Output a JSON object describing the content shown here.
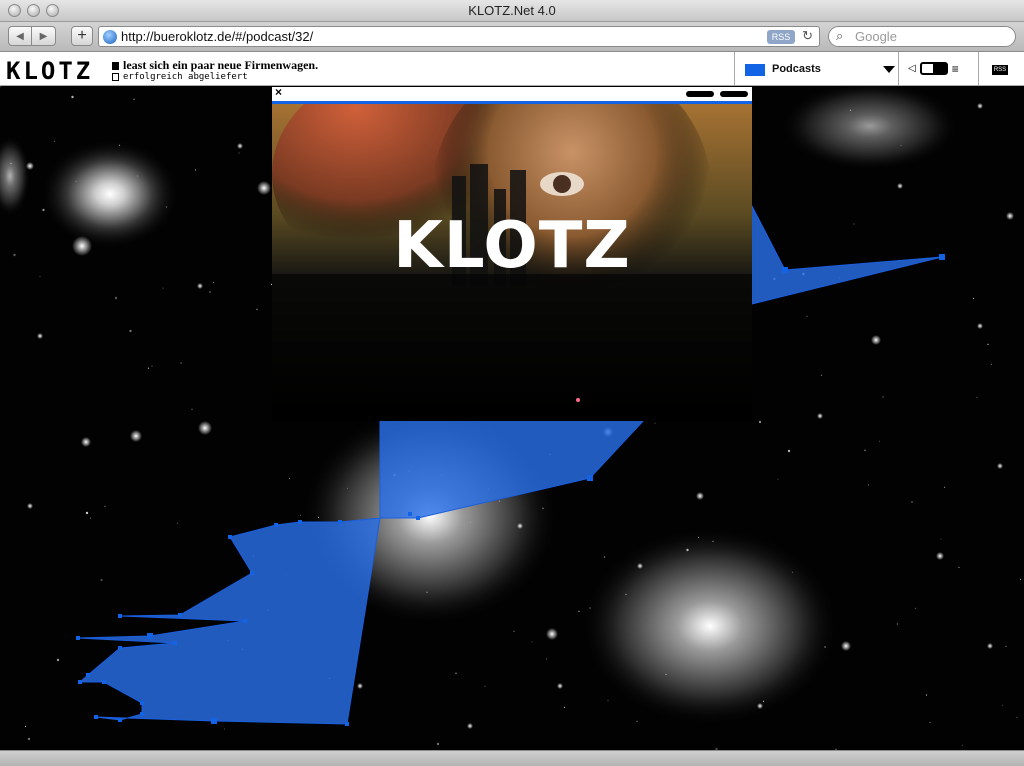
{
  "window": {
    "title": "KLOTZ.Net 4.0"
  },
  "browser": {
    "url": "http://bueroklotz.de/#/podcast/32/",
    "rss_badge": "RSS",
    "search_placeholder": "Google"
  },
  "site": {
    "logo": "KLOTZ",
    "ticker_line1": "least sich ein paar neue Firmenwagen.",
    "ticker_line2": "erfolgreich abgeliefert",
    "category": {
      "label": "Podcasts",
      "color": "#1363e6"
    },
    "rss_label": "RSS"
  },
  "popup": {
    "close": "×",
    "hero_text": "KLOTZ"
  },
  "colors": {
    "accent_blue": "#1363e6",
    "polygon_fill": "#2a6fe8"
  }
}
